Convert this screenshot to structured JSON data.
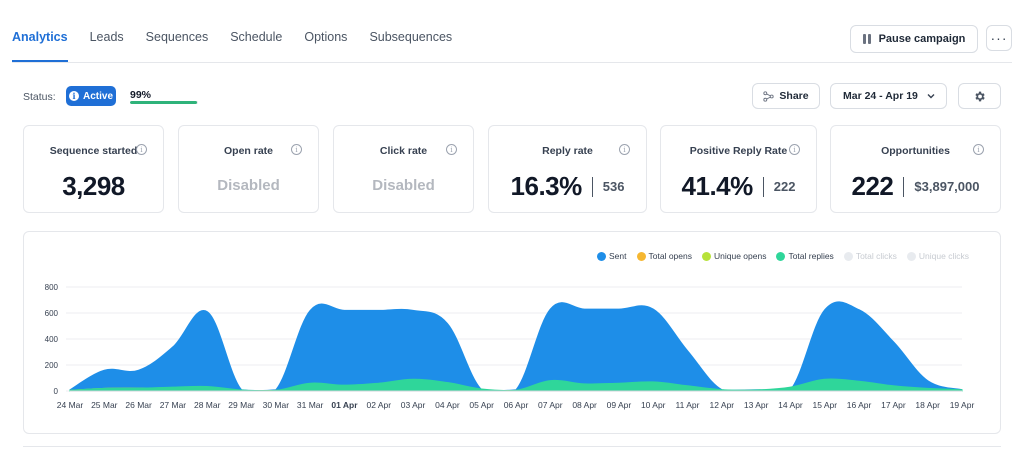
{
  "tabs": [
    {
      "label": "Analytics",
      "active": true
    },
    {
      "label": "Leads",
      "active": false
    },
    {
      "label": "Sequences",
      "active": false
    },
    {
      "label": "Schedule",
      "active": false
    },
    {
      "label": "Options",
      "active": false
    },
    {
      "label": "Subsequences",
      "active": false
    }
  ],
  "header": {
    "pause_label": "Pause campaign",
    "more_label": "···"
  },
  "status": {
    "label": "Status:",
    "badge": "Active",
    "progress_text": "99%",
    "progress_value": 0.99
  },
  "toolbar": {
    "share_label": "Share",
    "date_range": "Mar 24 - Apr 19"
  },
  "cards": [
    {
      "title": "Sequence started",
      "value": "3,298"
    },
    {
      "title": "Open rate",
      "disabled": "Disabled"
    },
    {
      "title": "Click rate",
      "disabled": "Disabled"
    },
    {
      "title": "Reply rate",
      "value": "16.3%",
      "sub": "536"
    },
    {
      "title": "Positive Reply Rate",
      "value": "41.4%",
      "sub": "222"
    },
    {
      "title": "Opportunities",
      "value": "222",
      "sub": "$3,897,000"
    }
  ],
  "colors": {
    "accent": "#1f6fd6",
    "progress": "#2fb37a"
  },
  "chart_data": {
    "type": "area",
    "x": [
      "24 Mar",
      "25 Mar",
      "26 Mar",
      "27 Mar",
      "28 Mar",
      "29 Mar",
      "30 Mar",
      "31 Mar",
      "01 Apr",
      "02 Apr",
      "03 Apr",
      "04 Apr",
      "05 Apr",
      "06 Apr",
      "07 Apr",
      "08 Apr",
      "09 Apr",
      "10 Apr",
      "11 Apr",
      "12 Apr",
      "13 Apr",
      "14 Apr",
      "15 Apr",
      "16 Apr",
      "17 Apr",
      "18 Apr",
      "19 Apr"
    ],
    "bold_ticks": [
      "01 Apr"
    ],
    "yticks": [
      0,
      200,
      400,
      600,
      800
    ],
    "ylim": [
      0,
      800
    ],
    "grid": true,
    "legend_position": "top-right",
    "series": [
      {
        "name": "Sent",
        "color": "#1e8ee8",
        "values": [
          10,
          160,
          160,
          340,
          610,
          10,
          10,
          620,
          620,
          620,
          620,
          520,
          10,
          10,
          630,
          630,
          630,
          630,
          310,
          10,
          10,
          10,
          625,
          625,
          380,
          80,
          10
        ]
      },
      {
        "name": "Total opens",
        "color": "#f5b731",
        "values": [
          0,
          0,
          0,
          0,
          0,
          0,
          0,
          0,
          0,
          0,
          0,
          0,
          0,
          0,
          0,
          0,
          0,
          0,
          0,
          0,
          0,
          0,
          0,
          0,
          0,
          0,
          0
        ]
      },
      {
        "name": "Unique opens",
        "color": "#b7e23a",
        "values": [
          5,
          20,
          22,
          25,
          28,
          5,
          5,
          25,
          25,
          25,
          25,
          25,
          5,
          5,
          25,
          25,
          25,
          25,
          20,
          5,
          5,
          5,
          25,
          25,
          22,
          10,
          5
        ]
      },
      {
        "name": "Total replies",
        "color": "#2fd69a",
        "values": [
          5,
          20,
          22,
          30,
          35,
          8,
          5,
          60,
          45,
          60,
          90,
          65,
          15,
          5,
          80,
          55,
          60,
          70,
          40,
          10,
          8,
          30,
          90,
          75,
          40,
          20,
          10
        ]
      },
      {
        "name": "Total clicks",
        "color": "#e8ebef",
        "muted": true,
        "values": [
          0,
          0,
          0,
          0,
          0,
          0,
          0,
          0,
          0,
          0,
          0,
          0,
          0,
          0,
          0,
          0,
          0,
          0,
          0,
          0,
          0,
          0,
          0,
          0,
          0,
          0,
          0
        ]
      },
      {
        "name": "Unique clicks",
        "color": "#e8ebef",
        "muted": true,
        "values": [
          0,
          0,
          0,
          0,
          0,
          0,
          0,
          0,
          0,
          0,
          0,
          0,
          0,
          0,
          0,
          0,
          0,
          0,
          0,
          0,
          0,
          0,
          0,
          0,
          0,
          0,
          0
        ]
      }
    ]
  }
}
